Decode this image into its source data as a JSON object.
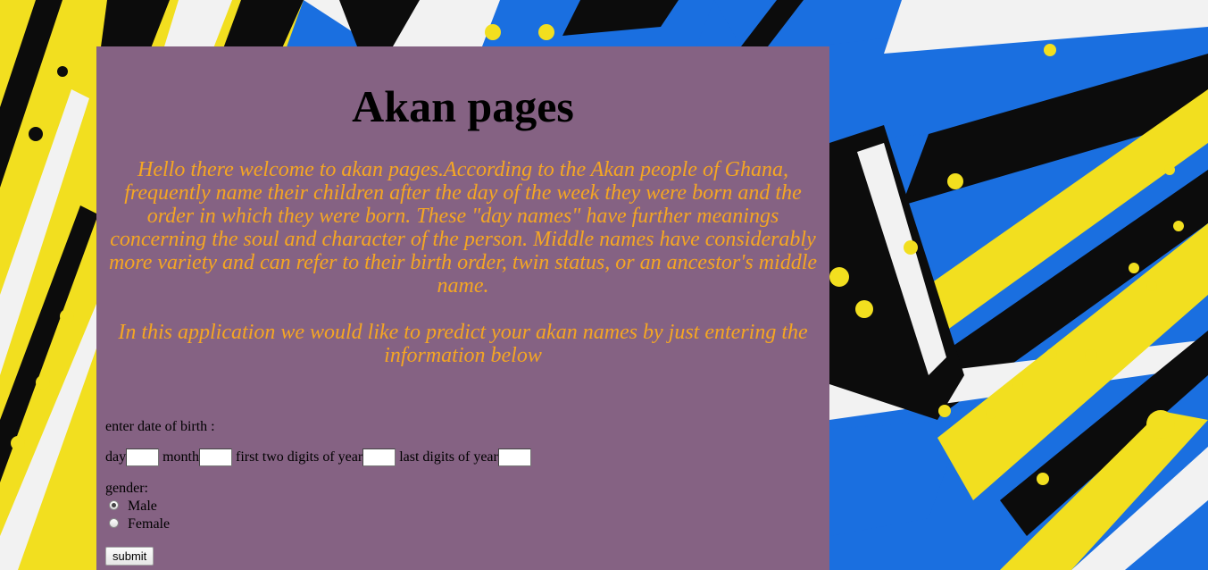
{
  "page": {
    "title": "Akan pages",
    "intro": "Hello there welcome to akan pages.According to the Akan people of Ghana, frequently name their children after the day of the week they were born and the order in which they were born. These \"day names\" have further meanings concerning the soul and character of the person. Middle names have considerably more variety and can refer to their birth order, twin status, or an ancestor's middle name.",
    "prompt": "In this application we would like to predict your akan names by just entering the information below"
  },
  "form": {
    "dob_label": "enter date of birth :",
    "day_label": "day",
    "day_value": "",
    "month_label": "month",
    "month_value": "",
    "century_label": "first two digits of year",
    "century_value": "",
    "year_label": "last digits of year",
    "year_value": "",
    "gender_label": "gender:",
    "gender_options": [
      "Male",
      "Female"
    ],
    "gender_selected": "Male",
    "submit_label": "submit"
  },
  "colors": {
    "panel_bg": "#856283",
    "intro_text": "#f5a623",
    "background_pattern": [
      "#1a6fe0",
      "#f2df1f",
      "#0c0c0c",
      "#f2f2f2"
    ]
  }
}
